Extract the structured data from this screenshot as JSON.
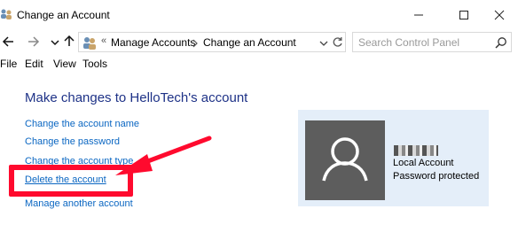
{
  "window": {
    "title": "Change an Account",
    "minimize_icon": "minimize-icon",
    "maximize_icon": "maximize-icon",
    "close_icon": "close-icon"
  },
  "navigation": {
    "back_icon": "arrow-left-icon",
    "forward_icon": "arrow-right-icon",
    "recent_icon": "chevron-down-icon",
    "up_icon": "arrow-up-icon",
    "address": {
      "separator": "«",
      "breadcrumbs": [
        "Manage Accounts",
        "Change an Account"
      ],
      "refresh_icon": "refresh-icon"
    },
    "search": {
      "placeholder": "Search Control Panel",
      "icon": "search-icon"
    }
  },
  "menu": {
    "items": [
      "File",
      "Edit",
      "View",
      "Tools"
    ]
  },
  "main": {
    "heading": "Make changes to HelloTech's account",
    "links": {
      "change_name": "Change the account name",
      "change_password": "Change the password",
      "change_type": "Change the account type",
      "delete": "Delete the account",
      "manage_other": "Manage another account"
    }
  },
  "account_card": {
    "avatar_icon": "user-avatar-icon",
    "type": "Local Account",
    "status": "Password protected"
  },
  "annotation": {
    "color": "#ff0a2e"
  },
  "colors": {
    "heading": "#1e3287",
    "link": "#0a66c2",
    "card_bg": "#e4eef9",
    "avatar_bg": "#5d5d5d"
  }
}
